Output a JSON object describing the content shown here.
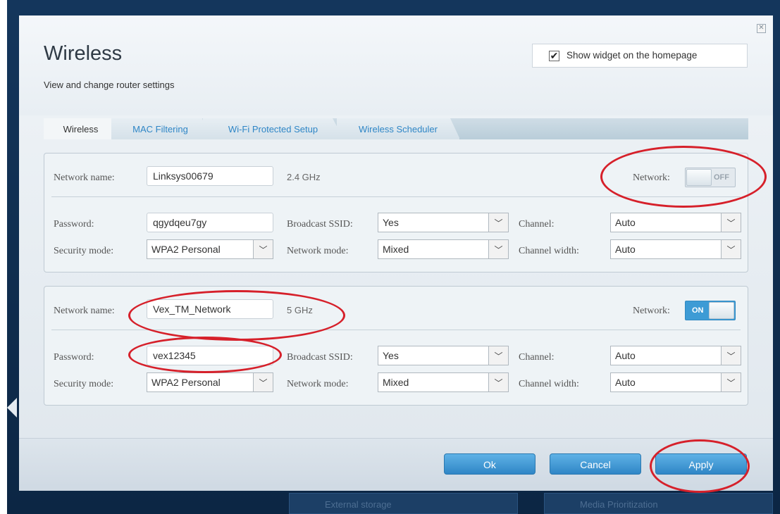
{
  "dialog": {
    "title": "Wireless",
    "subtitle": "View and change router settings",
    "close_glyph": "✕",
    "widget_checkbox": {
      "label": "Show widget on the homepage",
      "checked_glyph": "✔"
    }
  },
  "tabs": [
    {
      "label": "Wireless",
      "active": true
    },
    {
      "label": "MAC Filtering"
    },
    {
      "label": "Wi-Fi Protected Setup"
    },
    {
      "label": "Wireless Scheduler"
    }
  ],
  "labels": {
    "network_name": "Network name:",
    "network": "Network:",
    "password": "Password:",
    "security_mode": "Security mode:",
    "broadcast_ssid": "Broadcast SSID:",
    "network_mode": "Network mode:",
    "channel": "Channel:",
    "channel_width": "Channel width:"
  },
  "bands": [
    {
      "network_name": "Linksys00679",
      "frequency": "2.4 GHz",
      "network_toggle": "OFF",
      "password": "qgydqeu7gy",
      "security_mode": "WPA2 Personal",
      "broadcast_ssid": "Yes",
      "network_mode": "Mixed",
      "channel": "Auto",
      "channel_width": "Auto"
    },
    {
      "network_name": "Vex_TM_Network",
      "frequency": "5 GHz",
      "network_toggle": "ON",
      "password": "vex12345",
      "security_mode": "WPA2 Personal",
      "broadcast_ssid": "Yes",
      "network_mode": "Mixed",
      "channel": "Auto",
      "channel_width": "Auto"
    }
  ],
  "caret_glyph": "﹀",
  "footer": {
    "ok": "Ok",
    "cancel": "Cancel",
    "apply": "Apply"
  },
  "background_tiles": [
    "External storage",
    "Media Prioritization"
  ],
  "colors": {
    "accent": "#2f86c6",
    "annotation": "#d6202a",
    "toggle_on": "#3d9bd5"
  }
}
